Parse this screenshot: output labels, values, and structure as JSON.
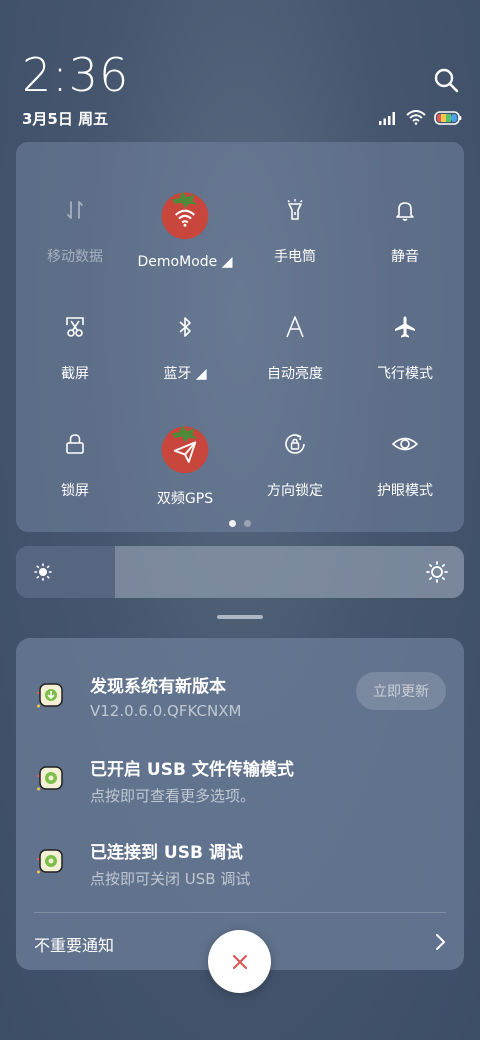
{
  "status": {
    "time": "2:36",
    "date": "3月5日 周五",
    "icons": [
      "signal-icon",
      "wifi-icon",
      "battery-icon"
    ]
  },
  "quick_settings": {
    "tiles": [
      {
        "label": "移动数据",
        "icon": "mobile-data-icon",
        "active": false
      },
      {
        "label": "DemoMode ◢",
        "icon": "wifi-icon",
        "active": true
      },
      {
        "label": "手电筒",
        "icon": "flashlight-icon",
        "active": false
      },
      {
        "label": "静音",
        "icon": "bell-icon",
        "active": false
      },
      {
        "label": "截屏",
        "icon": "screenshot-icon",
        "active": false
      },
      {
        "label": "蓝牙 ◢",
        "icon": "bluetooth-icon",
        "active": false
      },
      {
        "label": "自动亮度",
        "icon": "auto-brightness-icon",
        "active": false
      },
      {
        "label": "飞行模式",
        "icon": "airplane-icon",
        "active": false
      },
      {
        "label": "锁屏",
        "icon": "lock-icon",
        "active": false
      },
      {
        "label": "双频GPS",
        "icon": "location-icon",
        "active": true
      },
      {
        "label": "方向锁定",
        "icon": "rotation-lock-icon",
        "active": false
      },
      {
        "label": "护眼模式",
        "icon": "eye-icon",
        "active": false
      }
    ],
    "page_count": 2,
    "current_page": 1
  },
  "brightness": {
    "level": 0.22
  },
  "notifications": {
    "items": [
      {
        "title": "发现系统有新版本",
        "subtitle": "V12.0.6.0.QFKCNXM",
        "action": "立即更新"
      },
      {
        "title": "已开启 USB 文件传输模式",
        "subtitle": "点按即可查看更多选项。"
      },
      {
        "title": "已连接到 USB 调试",
        "subtitle": "点按即可关闭 USB 调试"
      }
    ],
    "footer_label": "不重要通知"
  },
  "colors": {
    "accent_tomato": "#c8463c",
    "leaf": "#4f8a3a"
  }
}
